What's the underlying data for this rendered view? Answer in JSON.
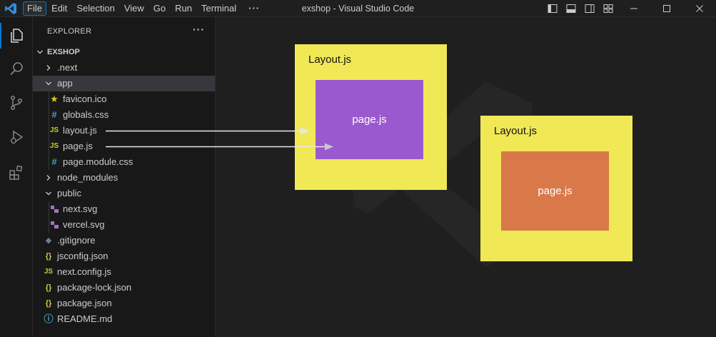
{
  "menu": [
    "File",
    "Edit",
    "Selection",
    "View",
    "Go",
    "Run",
    "Terminal"
  ],
  "menu_more": "···",
  "window_title": "exshop - Visual Studio Code",
  "explorer": {
    "header": "EXPLORER",
    "more": "···",
    "root": "EXSHOP",
    "items": [
      {
        "label": ".next",
        "type": "folder",
        "expanded": false
      },
      {
        "label": "app",
        "type": "folder",
        "expanded": true
      },
      {
        "label": "favicon.ico",
        "icon": "★"
      },
      {
        "label": "globals.css",
        "icon": "#"
      },
      {
        "label": "layout.js",
        "icon": "JS"
      },
      {
        "label": "page.js",
        "icon": "JS"
      },
      {
        "label": "page.module.css",
        "icon": "#"
      },
      {
        "label": "node_modules",
        "type": "folder",
        "expanded": false
      },
      {
        "label": "public",
        "type": "folder",
        "expanded": true
      },
      {
        "label": "next.svg",
        "icon": "svg-icon"
      },
      {
        "label": "vercel.svg",
        "icon": "svg-icon"
      },
      {
        "label": ".gitignore",
        "icon": "◆"
      },
      {
        "label": "jsconfig.json",
        "icon": "{}"
      },
      {
        "label": "next.config.js",
        "icon": "JS"
      },
      {
        "label": "package-lock.json",
        "icon": "{}"
      },
      {
        "label": "package.json",
        "icon": "{}"
      },
      {
        "label": "README.md",
        "icon": "ⓘ"
      }
    ]
  },
  "diagram": {
    "layout_label": "Layout.js",
    "page_label": "page.js",
    "colors": {
      "layout": "#f1e856",
      "page_purple": "#9b59cf",
      "page_orange": "#d9794a"
    }
  }
}
